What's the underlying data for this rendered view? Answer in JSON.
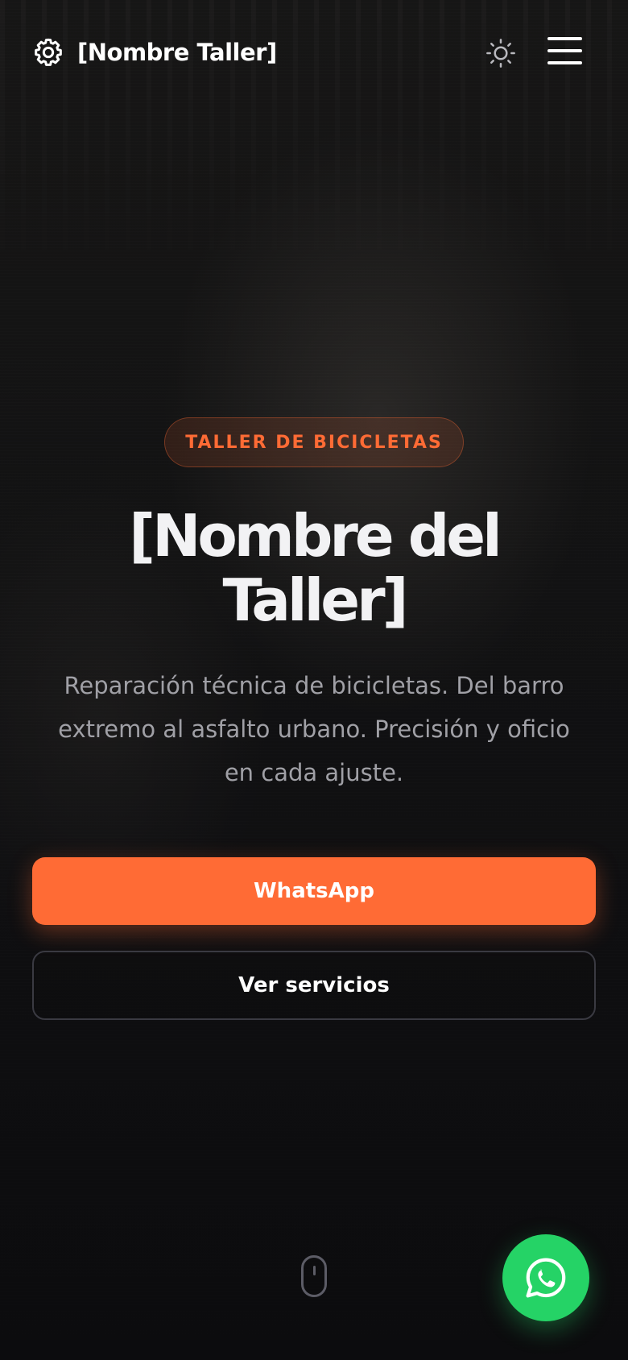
{
  "header": {
    "brand_icon": "gear-icon",
    "brand_name": "[Nombre Taller]",
    "theme_toggle_icon": "sun-icon",
    "menu_icon": "hamburger-menu-icon"
  },
  "hero": {
    "badge": "TALLER DE BICICLETAS",
    "title_line1": "[Nombre del",
    "title_line2": "Taller]",
    "subtitle": "Reparación técnica de bicicletas. Del barro extremo al asfalto urbano. Precisión y oficio en cada ajuste.",
    "primary_button": "WhatsApp",
    "secondary_button": "Ver servicios",
    "scroll_indicator_icon": "mouse-scroll-icon"
  },
  "floating": {
    "whatsapp_icon": "whatsapp-icon"
  },
  "colors": {
    "accent": "#ff6b35",
    "whatsapp": "#25d366",
    "background": "#0e0e11",
    "text": "#f2f2f4",
    "muted_text": "#a0a0a6"
  }
}
